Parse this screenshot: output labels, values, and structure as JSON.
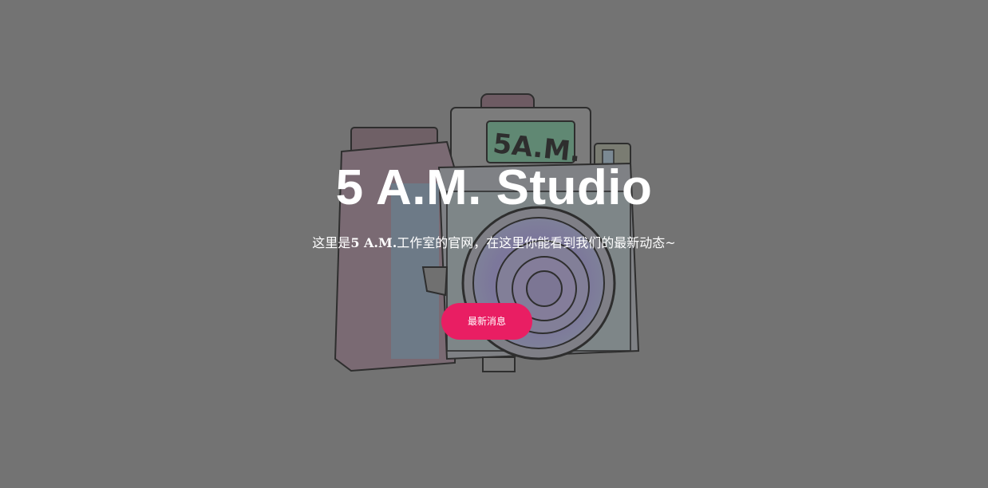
{
  "hero": {
    "title": "5 A.M. Studio",
    "subtitle_prefix": "这里是",
    "subtitle_strong": "5 A.M.",
    "subtitle_suffix": "工作室的官网，在这里你能看到我们的最新动态~",
    "cta_label": "最新消息",
    "background_image": "camera-illustration",
    "camera_label": "5A.M."
  },
  "colors": {
    "overlay": "#737373",
    "accent": "#e91e63",
    "text": "#ffffff"
  }
}
